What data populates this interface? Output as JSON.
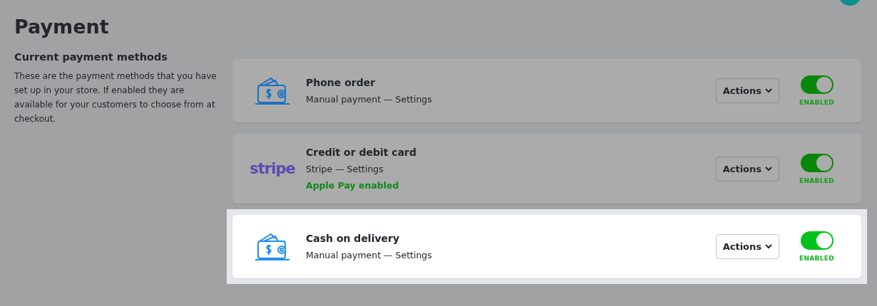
{
  "page": {
    "title": "Payment"
  },
  "intro": {
    "heading": "Current payment methods",
    "text": "These are the payment methods that you have set up in your store. If enabled they are available for your customers to choose from at checkout."
  },
  "methods": [
    {
      "logo": {
        "kind": "wallet"
      },
      "name": "Phone order",
      "provider": "Manual payment — Settings",
      "actions": "Actions",
      "enabled": true,
      "status": "ENABLED",
      "highlighted": false
    },
    {
      "logo": {
        "kind": "wordmark",
        "text": "stripe"
      },
      "name": "Credit or debit card",
      "provider": "Stripe — Settings",
      "note": "Apple Pay enabled",
      "actions": "Actions",
      "enabled": true,
      "status": "ENABLED",
      "highlighted": false
    },
    {
      "logo": {
        "kind": "wallet"
      },
      "name": "Cash on delivery",
      "provider": "Manual payment — Settings",
      "actions": "Actions",
      "enabled": true,
      "status": "ENABLED",
      "highlighted": true
    }
  ]
}
